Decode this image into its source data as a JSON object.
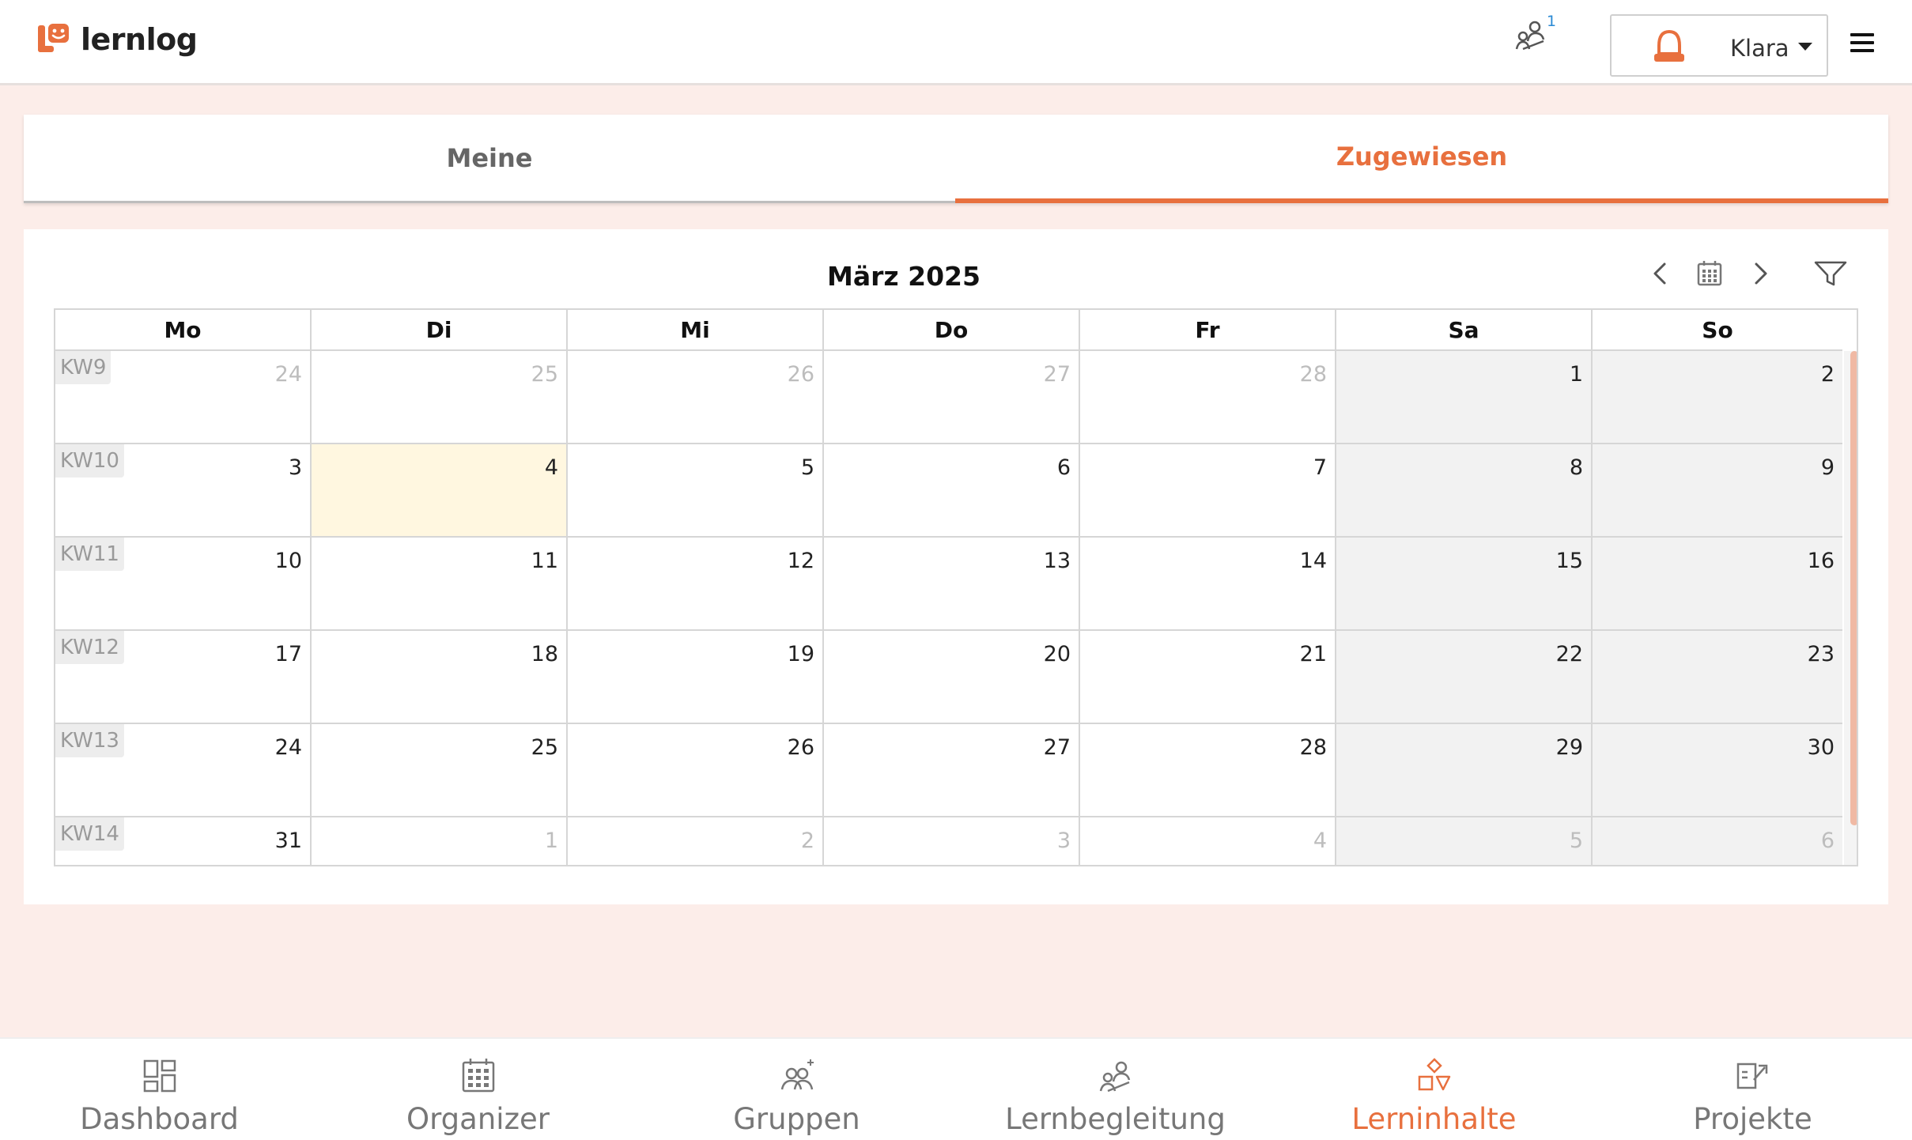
{
  "app": {
    "name": "lernlog"
  },
  "header": {
    "notification_count": "1",
    "user_name": "Klara"
  },
  "tabs": [
    {
      "label": "Meine",
      "active": false
    },
    {
      "label": "Zugewiesen",
      "active": true
    }
  ],
  "calendar": {
    "title": "März 2025",
    "weekdays": [
      "Mo",
      "Di",
      "Mi",
      "Do",
      "Fr",
      "Sa",
      "So"
    ],
    "weeks": [
      {
        "kw": "KW9",
        "days": [
          {
            "n": "24",
            "out": true
          },
          {
            "n": "25",
            "out": true
          },
          {
            "n": "26",
            "out": true
          },
          {
            "n": "27",
            "out": true
          },
          {
            "n": "28",
            "out": true
          },
          {
            "n": "1"
          },
          {
            "n": "2"
          }
        ]
      },
      {
        "kw": "KW10",
        "days": [
          {
            "n": "3"
          },
          {
            "n": "4",
            "today": true
          },
          {
            "n": "5"
          },
          {
            "n": "6"
          },
          {
            "n": "7"
          },
          {
            "n": "8"
          },
          {
            "n": "9"
          }
        ]
      },
      {
        "kw": "KW11",
        "days": [
          {
            "n": "10"
          },
          {
            "n": "11"
          },
          {
            "n": "12"
          },
          {
            "n": "13"
          },
          {
            "n": "14"
          },
          {
            "n": "15"
          },
          {
            "n": "16"
          }
        ]
      },
      {
        "kw": "KW12",
        "days": [
          {
            "n": "17"
          },
          {
            "n": "18"
          },
          {
            "n": "19"
          },
          {
            "n": "20"
          },
          {
            "n": "21"
          },
          {
            "n": "22"
          },
          {
            "n": "23"
          }
        ]
      },
      {
        "kw": "KW13",
        "days": [
          {
            "n": "24"
          },
          {
            "n": "25"
          },
          {
            "n": "26"
          },
          {
            "n": "27"
          },
          {
            "n": "28"
          },
          {
            "n": "29"
          },
          {
            "n": "30"
          }
        ]
      },
      {
        "kw": "KW14",
        "days": [
          {
            "n": "31"
          },
          {
            "n": "1",
            "out": true
          },
          {
            "n": "2",
            "out": true
          },
          {
            "n": "3",
            "out": true
          },
          {
            "n": "4",
            "out": true
          },
          {
            "n": "5",
            "out": true
          },
          {
            "n": "6",
            "out": true
          }
        ]
      }
    ]
  },
  "bottom_nav": [
    {
      "label": "Dashboard",
      "icon": "dashboard-icon",
      "active": false
    },
    {
      "label": "Organizer",
      "icon": "calendar-grid-icon",
      "active": false
    },
    {
      "label": "Gruppen",
      "icon": "group-icon",
      "active": false
    },
    {
      "label": "Lernbegleitung",
      "icon": "mentor-icon",
      "active": false
    },
    {
      "label": "Lerninhalte",
      "icon": "shapes-icon",
      "active": true
    },
    {
      "label": "Projekte",
      "icon": "projects-icon",
      "active": false
    }
  ],
  "colors": {
    "accent": "#e8703e",
    "today": "#fff7e0",
    "weekend": "#f2f2f2",
    "background": "#fcede9"
  }
}
